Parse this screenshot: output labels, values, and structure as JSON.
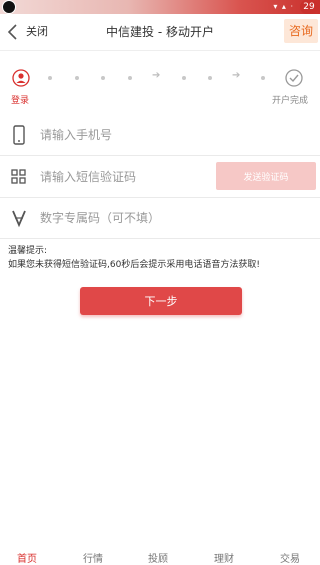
{
  "status_bar": {
    "badge": "29",
    "dots": "▾ ▴ ·"
  },
  "navbar": {
    "close_label": "关闭",
    "title": "中信建投 - 移动开户",
    "consult_label": "咨询"
  },
  "steps": {
    "start_label": "登录",
    "end_label": "开户完成"
  },
  "form": {
    "phone_placeholder": "请输入手机号",
    "sms_placeholder": "请输入短信验证码",
    "send_code_label": "发送验证码",
    "referral_placeholder": "数字专属码（可不填）"
  },
  "tip": {
    "title": "温馨提示:",
    "text": "如果您未获得短信验证码,60秒后会提示采用电话语音方法获取!"
  },
  "next_label": "下一步",
  "tabbar": {
    "items": [
      "首页",
      "行情",
      "投顾",
      "理财",
      "交易"
    ],
    "active_index": 0
  },
  "colors": {
    "brand_red": "#e04848",
    "consult_orange": "#e86a1f",
    "send_code_disabled": "#f6c8c6"
  }
}
